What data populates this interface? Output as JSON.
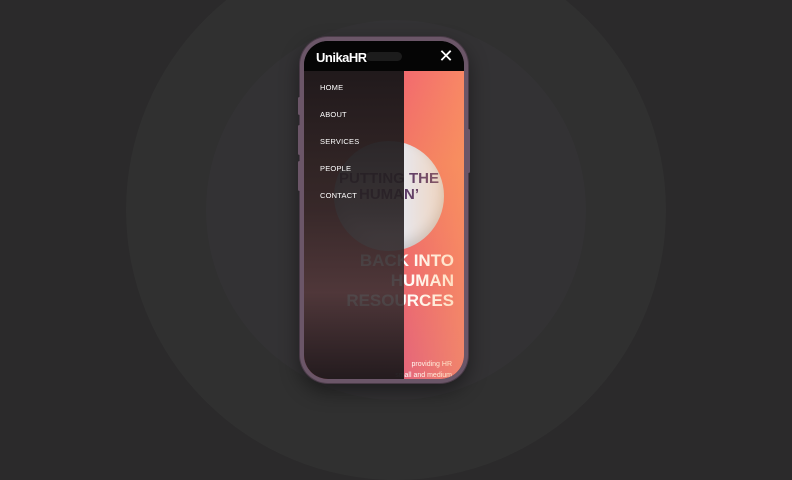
{
  "app": {
    "logo": "UnikaHR",
    "close_icon": "close-icon"
  },
  "menu": {
    "items": [
      {
        "label": "HOME"
      },
      {
        "label": "ABOUT"
      },
      {
        "label": "SERVICES"
      },
      {
        "label": "PEOPLE"
      },
      {
        "label": "CONTACT"
      }
    ]
  },
  "hero": {
    "badge_line1": "PUTTING THE",
    "badge_line2": "HUMAN’",
    "headline_line1": "BACK INTO",
    "headline_line2": "HUMAN",
    "headline_line3": "RESOURCES",
    "subtext_line1": "providing HR",
    "subtext_line2": "small and medium"
  },
  "colors": {
    "background": "#2b2a2b",
    "phone_frame": "#6b5668",
    "gradient_start": "#f26a6f",
    "gradient_end": "#e4667b",
    "badge_text": "#5a3a68"
  }
}
